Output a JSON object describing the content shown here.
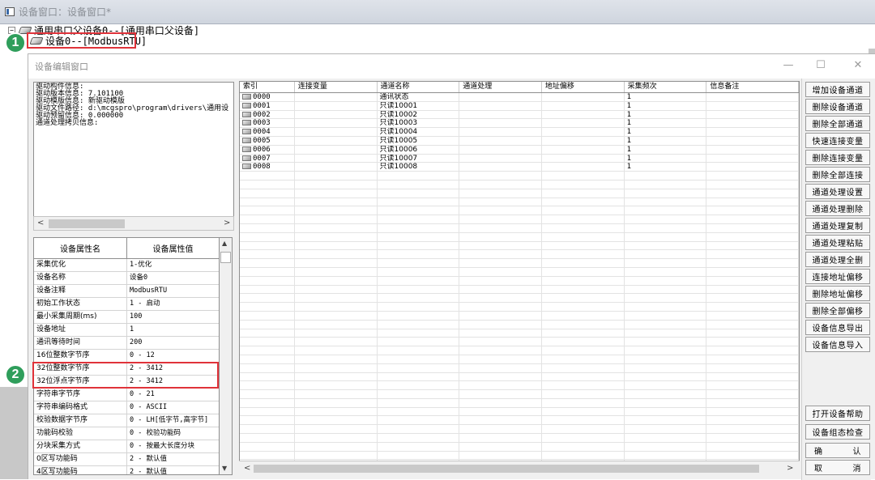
{
  "outer": {
    "title": "设备窗口：设备窗口*",
    "tree_root_label": "通用串口父设备0--[通用串口父设备]",
    "tree_child_label": "设备0--[ModbusRTU]"
  },
  "badges": [
    "1",
    "2"
  ],
  "edit_window": {
    "title": "设备编辑窗口",
    "controls": {
      "minimize": "—",
      "maximize": "☐",
      "close": "✕"
    }
  },
  "driver_info": [
    "驱动构件信息:",
    "驱动版本信息: 7.101100",
    "驱动模版信息: 新驱动模版",
    "驱动文件路径: d:\\mcgspro\\program\\drivers\\通用设",
    "驱动预留信息: 0.000000",
    "通道处理拷贝信息:"
  ],
  "property_grid": {
    "headers": [
      "设备属性名",
      "设备属性值"
    ],
    "rows": [
      [
        "采集优化",
        "1-优化"
      ],
      [
        "设备名称",
        "设备0"
      ],
      [
        "设备注释",
        "ModbusRTU"
      ],
      [
        "初始工作状态",
        "1 - 启动"
      ],
      [
        "最小采集周期(ms)",
        "100"
      ],
      [
        "设备地址",
        "1"
      ],
      [
        "通讯等待时间",
        "200"
      ],
      [
        "16位整数字节序",
        "0 - 12"
      ],
      [
        "32位整数字节序",
        "2 - 3412"
      ],
      [
        "32位浮点字节序",
        "2 - 3412"
      ],
      [
        "字符串字节序",
        "0 - 21"
      ],
      [
        "字符串编码格式",
        "0 - ASCII"
      ],
      [
        "校验数据字节序",
        "0 - LH[低字节,高字节]"
      ],
      [
        "功能码校验",
        "0 - 校验功能码"
      ],
      [
        "分块采集方式",
        "0 - 按最大长度分块"
      ],
      [
        "0区写功能码",
        "2 - 默认值"
      ],
      [
        "4区写功能码",
        "2 - 默认值"
      ]
    ]
  },
  "channel_table": {
    "headers": [
      "索引",
      "连接变量",
      "通道名称",
      "通道处理",
      "地址偏移",
      "采集频次",
      "信息备注"
    ],
    "rows": [
      [
        "0000",
        "",
        "通讯状态",
        "",
        "",
        "1",
        ""
      ],
      [
        "0001",
        "",
        "只读10001",
        "",
        "",
        "1",
        ""
      ],
      [
        "0002",
        "",
        "只读10002",
        "",
        "",
        "1",
        ""
      ],
      [
        "0003",
        "",
        "只读10003",
        "",
        "",
        "1",
        ""
      ],
      [
        "0004",
        "",
        "只读10004",
        "",
        "",
        "1",
        ""
      ],
      [
        "0005",
        "",
        "只读10005",
        "",
        "",
        "1",
        ""
      ],
      [
        "0006",
        "",
        "只读10006",
        "",
        "",
        "1",
        ""
      ],
      [
        "0007",
        "",
        "只读10007",
        "",
        "",
        "1",
        ""
      ],
      [
        "0008",
        "",
        "只读10008",
        "",
        "",
        "1",
        ""
      ]
    ]
  },
  "buttons": [
    "增加设备通道",
    "删除设备通道",
    "删除全部通道",
    "快速连接变量",
    "删除连接变量",
    "删除全部连接",
    "通道处理设置",
    "通道处理删除",
    "通道处理复制",
    "通道处理粘贴",
    "通道处理全删",
    "连接地址偏移",
    "删除地址偏移",
    "删除全部偏移",
    "设备信息导出",
    "设备信息导入"
  ],
  "bottom_buttons": [
    "打开设备帮助",
    "设备组态检查"
  ],
  "confirm_button": [
    "确",
    "认"
  ],
  "cancel_button": [
    "取",
    "消"
  ],
  "scroll_arrows": {
    "left": "<",
    "right": ">",
    "up": "▲",
    "down": "▼"
  }
}
